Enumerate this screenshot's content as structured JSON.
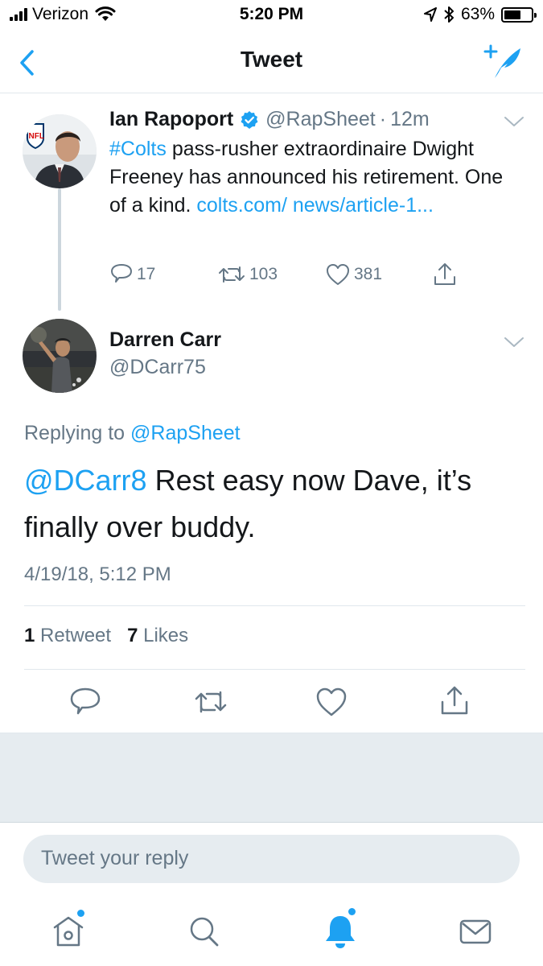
{
  "status_bar": {
    "carrier": "Verizon",
    "time": "5:20 PM",
    "battery": "63%",
    "battery_level": 0.63
  },
  "nav": {
    "title": "Tweet"
  },
  "parent_tweet": {
    "name": "Ian Rapoport",
    "handle": "@RapSheet",
    "separator": "·",
    "time": "12m",
    "hashtag": "#Colts",
    "text": " pass-rusher extraordinaire Dwight Freeney has announced his retirement. One of a kind. ",
    "link": "colts.com/ news/article-1...",
    "replies": "17",
    "retweets": "103",
    "likes": "381"
  },
  "main_tweet": {
    "name": "Darren Carr",
    "handle": "@DCarr75",
    "replying_prefix": "Replying to ",
    "replying_to": "@RapSheet",
    "mention": "@DCarr8",
    "text": " Rest easy now Dave, it’s finally over buddy.",
    "date": "4/19/18, 5:12 PM",
    "retweet_count": "1",
    "retweet_label": " Retweet",
    "like_count": "7",
    "like_label": " Likes"
  },
  "reply_box": {
    "placeholder": "Tweet your reply"
  },
  "colors": {
    "accent": "#1da1f2",
    "secondary_text": "#657786",
    "divider": "#e1e8ed"
  },
  "icons": [
    "back-chevron-icon",
    "compose-feather-icon",
    "verified-badge-icon",
    "reply-icon",
    "retweet-icon",
    "like-icon",
    "share-icon",
    "home-icon",
    "search-icon",
    "notifications-icon",
    "messages-icon"
  ]
}
